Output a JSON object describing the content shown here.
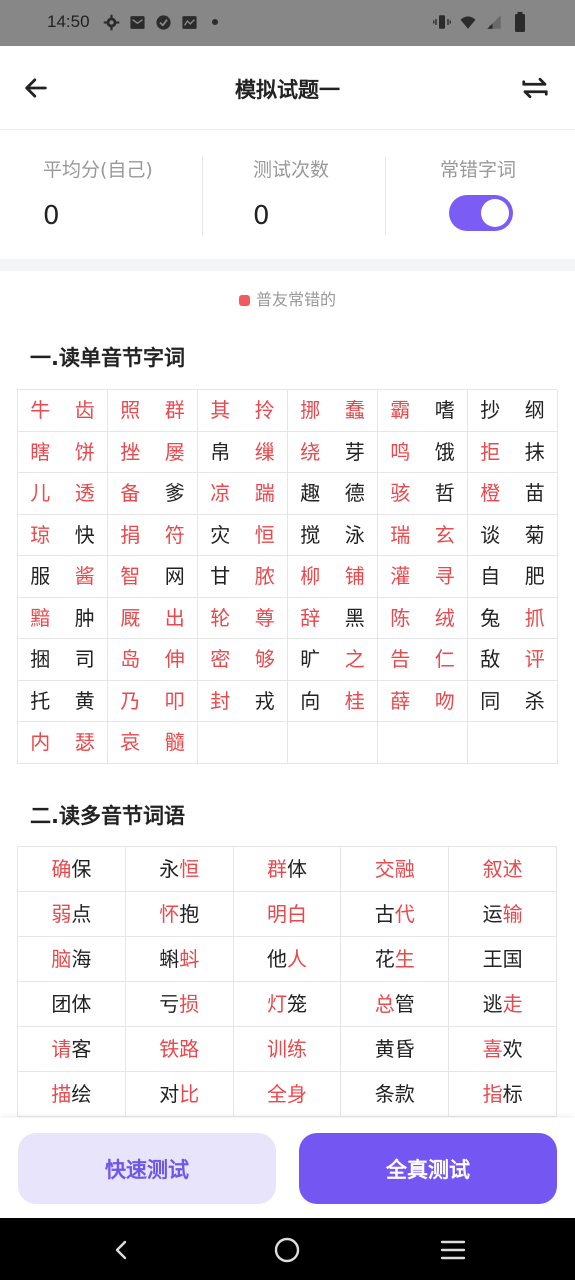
{
  "status_bar": {
    "time": "14:50",
    "left_icons": [
      "gear-icon",
      "mail-icon",
      "check-circle-icon",
      "message-icon",
      "dot-icon"
    ],
    "right_icons": [
      "vibrate-icon",
      "wifi-icon",
      "signal-icon",
      "battery-icon"
    ]
  },
  "header": {
    "title": "模拟试题一",
    "back_icon": "arrow-left-icon",
    "switch_icon": "swap-icon"
  },
  "stats": {
    "average_label": "平均分(自己)",
    "average_value": "0",
    "count_label": "测试次数",
    "count_value": "0",
    "mistakes_label": "常错字词",
    "mistakes_toggle_on": true,
    "accent_color": "#7b5cf4"
  },
  "legend": {
    "text": "普友常错的",
    "color": "#f05b5b"
  },
  "section1": {
    "title": "一.读单音节字词",
    "rows": [
      [
        [
          "牛",
          1
        ],
        [
          "齿",
          1
        ],
        [
          "照",
          1
        ],
        [
          "群",
          1
        ],
        [
          "其",
          1
        ],
        [
          "拎",
          1
        ],
        [
          "挪",
          1
        ],
        [
          "蠢",
          1
        ],
        [
          "霸",
          1
        ],
        [
          "嗜",
          0
        ],
        [
          "抄",
          0
        ],
        [
          "纲",
          0
        ]
      ],
      [
        [
          "瞎",
          1
        ],
        [
          "饼",
          1
        ],
        [
          "挫",
          1
        ],
        [
          "屡",
          1
        ],
        [
          "帛",
          0
        ],
        [
          "缫",
          1
        ],
        [
          "绕",
          1
        ],
        [
          "芽",
          0
        ],
        [
          "鸣",
          1
        ],
        [
          "饿",
          0
        ],
        [
          "拒",
          1
        ],
        [
          "抹",
          0
        ]
      ],
      [
        [
          "儿",
          1
        ],
        [
          "透",
          1
        ],
        [
          "备",
          1
        ],
        [
          "爹",
          0
        ],
        [
          "凉",
          1
        ],
        [
          "踹",
          1
        ],
        [
          "趣",
          0
        ],
        [
          "德",
          0
        ],
        [
          "骇",
          1
        ],
        [
          "哲",
          0
        ],
        [
          "橙",
          1
        ],
        [
          "苗",
          0
        ]
      ],
      [
        [
          "琼",
          1
        ],
        [
          "快",
          0
        ],
        [
          "捐",
          1
        ],
        [
          "符",
          1
        ],
        [
          "灾",
          0
        ],
        [
          "恒",
          1
        ],
        [
          "搅",
          0
        ],
        [
          "泳",
          0
        ],
        [
          "瑞",
          1
        ],
        [
          "玄",
          1
        ],
        [
          "谈",
          0
        ],
        [
          "菊",
          0
        ]
      ],
      [
        [
          "服",
          0
        ],
        [
          "酱",
          1
        ],
        [
          "智",
          1
        ],
        [
          "网",
          0
        ],
        [
          "甘",
          0
        ],
        [
          "脓",
          1
        ],
        [
          "柳",
          1
        ],
        [
          "铺",
          1
        ],
        [
          "灌",
          1
        ],
        [
          "寻",
          1
        ],
        [
          "自",
          0
        ],
        [
          "肥",
          0
        ]
      ],
      [
        [
          "黯",
          1
        ],
        [
          "肿",
          0
        ],
        [
          "厩",
          1
        ],
        [
          "出",
          1
        ],
        [
          "轮",
          1
        ],
        [
          "尊",
          1
        ],
        [
          "辞",
          1
        ],
        [
          "黑",
          0
        ],
        [
          "陈",
          1
        ],
        [
          "绒",
          1
        ],
        [
          "兔",
          0
        ],
        [
          "抓",
          1
        ]
      ],
      [
        [
          "捆",
          0
        ],
        [
          "司",
          0
        ],
        [
          "岛",
          1
        ],
        [
          "伸",
          1
        ],
        [
          "密",
          1
        ],
        [
          "够",
          1
        ],
        [
          "旷",
          0
        ],
        [
          "之",
          1
        ],
        [
          "告",
          1
        ],
        [
          "仁",
          1
        ],
        [
          "敌",
          0
        ],
        [
          "评",
          1
        ]
      ],
      [
        [
          "托",
          0
        ],
        [
          "黄",
          0
        ],
        [
          "乃",
          1
        ],
        [
          "叩",
          1
        ],
        [
          "封",
          1
        ],
        [
          "戎",
          0
        ],
        [
          "向",
          0
        ],
        [
          "桂",
          1
        ],
        [
          "薛",
          1
        ],
        [
          "吻",
          1
        ],
        [
          "同",
          0
        ],
        [
          "杀",
          0
        ]
      ],
      [
        [
          "内",
          1
        ],
        [
          "瑟",
          1
        ],
        [
          "哀",
          1
        ],
        [
          "髓",
          1
        ]
      ]
    ]
  },
  "section2": {
    "title": "二.读多音节词语",
    "rows": [
      [
        [
          [
            "确",
            1
          ],
          [
            "保",
            0
          ]
        ],
        [
          [
            "永",
            0
          ],
          [
            "恒",
            1
          ]
        ],
        [
          [
            "群",
            1
          ],
          [
            "体",
            0
          ]
        ],
        [
          [
            "交融",
            1
          ]
        ],
        [
          [
            "叙述",
            1
          ]
        ]
      ],
      [
        [
          [
            "弱",
            1
          ],
          [
            "点",
            0
          ]
        ],
        [
          [
            "怀",
            1
          ],
          [
            "抱",
            0
          ]
        ],
        [
          [
            "明白",
            1
          ]
        ],
        [
          [
            "古",
            0
          ],
          [
            "代",
            1
          ]
        ],
        [
          [
            "运",
            0
          ],
          [
            "输",
            1
          ]
        ]
      ],
      [
        [
          [
            "脑",
            1
          ],
          [
            "海",
            0
          ]
        ],
        [
          [
            "蝌",
            0
          ],
          [
            "蚪",
            1
          ]
        ],
        [
          [
            "他",
            0
          ],
          [
            "人",
            1
          ]
        ],
        [
          [
            "花",
            0
          ],
          [
            "生",
            1
          ]
        ],
        [
          [
            "王国",
            0
          ]
        ]
      ],
      [
        [
          [
            "团体",
            0
          ]
        ],
        [
          [
            "亏",
            0
          ],
          [
            "损",
            1
          ]
        ],
        [
          [
            "灯",
            1
          ],
          [
            "笼",
            0
          ]
        ],
        [
          [
            "总",
            1
          ],
          [
            "管",
            0
          ]
        ],
        [
          [
            "逃",
            0
          ],
          [
            "走",
            1
          ]
        ]
      ],
      [
        [
          [
            "请",
            1
          ],
          [
            "客",
            0
          ]
        ],
        [
          [
            "铁路",
            1
          ]
        ],
        [
          [
            "训练",
            1
          ]
        ],
        [
          [
            "黄昏",
            0
          ]
        ],
        [
          [
            "喜",
            1
          ],
          [
            "欢",
            0
          ]
        ]
      ],
      [
        [
          [
            "描",
            1
          ],
          [
            "绘",
            0
          ]
        ],
        [
          [
            "对",
            0
          ],
          [
            "比",
            1
          ]
        ],
        [
          [
            "全身",
            1
          ]
        ],
        [
          [
            "条款",
            0
          ]
        ],
        [
          [
            "指",
            1
          ],
          [
            "标",
            0
          ]
        ]
      ]
    ]
  },
  "buttons": {
    "quick_test": "快速测试",
    "full_test": "全真测试"
  },
  "nav": {
    "back_icon": "nav-back-icon",
    "home_icon": "nav-home-icon",
    "menu_icon": "nav-menu-icon"
  }
}
